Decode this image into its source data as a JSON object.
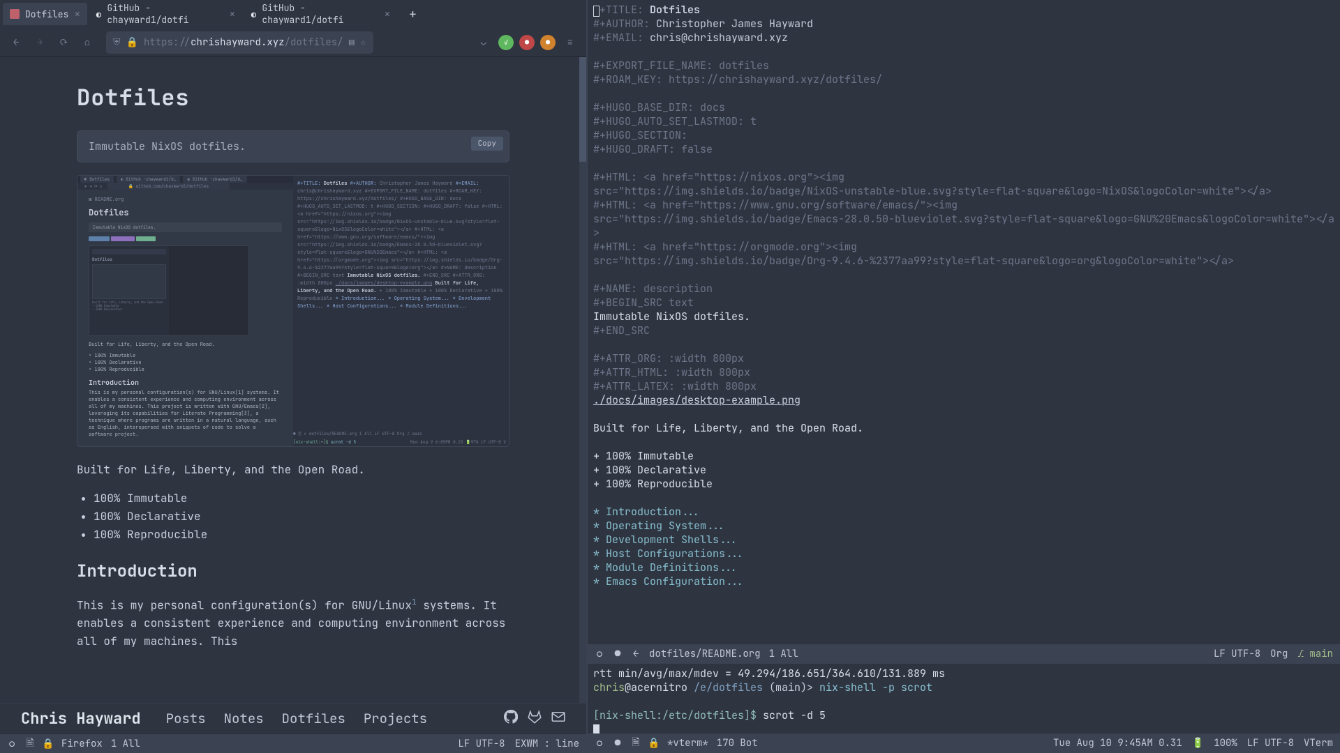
{
  "firefox": {
    "tabs": [
      {
        "label": "Dotfiles",
        "active": true
      },
      {
        "label": "GitHub - chayward1/dotfi"
      },
      {
        "label": "GitHub - chayward1/dotfi"
      }
    ],
    "url_prefix": "https://",
    "url_host": "chrishayward.xyz",
    "url_path": "/dotfiles/"
  },
  "page": {
    "title": "Dotfiles",
    "codebox": "Immutable NixOS dotfiles.",
    "copy": "Copy",
    "tagline": "Built for Life, Liberty, and the Open Road.",
    "features": [
      "100% Immutable",
      "100% Declarative",
      "100% Reproducible"
    ],
    "intro_heading": "Introduction",
    "intro_body_1": "This is my personal configuration(s) for GNU/Linux",
    "intro_sup": "1",
    "intro_body_2": " systems. It enables a consistent experience and computing environment across all of my machines. This"
  },
  "nav": {
    "brand": "Chris Hayward",
    "links": [
      "Posts",
      "Notes",
      "Dotfiles",
      "Projects"
    ]
  },
  "modeline_left": {
    "buffer": "Firefox",
    "pos": "1 All",
    "encoding": "LF UTF-8",
    "mode": "EXWM : line"
  },
  "editor": {
    "l01": {
      "k": "#+TITLE: ",
      "v": "Dotfiles"
    },
    "l02": {
      "k": "#+AUTHOR: ",
      "v": "Christopher James Hayward"
    },
    "l03": {
      "k": "#+EMAIL: ",
      "v": "chris@chrishayward.xyz"
    },
    "l04": "",
    "l05": "#+EXPORT_FILE_NAME: dotfiles",
    "l06": "#+ROAM_KEY: https://chrishayward.xyz/dotfiles/",
    "l07": "",
    "l08": "#+HUGO_BASE_DIR: docs",
    "l09": "#+HUGO_AUTO_SET_LASTMOD: t",
    "l10": "#+HUGO_SECTION:",
    "l11": "#+HUGO_DRAFT: false",
    "l12": "",
    "l13": "#+HTML: <a href=\"https://nixos.org\"><img",
    "l14": "src=\"https://img.shields.io/badge/NixOS-unstable-blue.svg?style=flat-square&logo=NixOS&logoColor=white\"></a>",
    "l15": "#+HTML: <a href=\"https://www.gnu.org/software/emacs/\"><img",
    "l16": "src=\"https://img.shields.io/badge/Emacs-28.0.50-blueviolet.svg?style=flat-square&logo=GNU%20Emacs&logoColor=white\"></a",
    "l17": ">",
    "l18": "#+HTML: <a href=\"https://orgmode.org\"><img",
    "l19": "src=\"https://img.shields.io/badge/Org-9.4.6-%2377aa99?style=flat-square&logo=org&logoColor=white\"></a>",
    "l20": "",
    "l21": "#+NAME: description",
    "l22": "#+BEGIN_SRC text",
    "l23": "Immutable NixOS dotfiles.",
    "l24": "#+END_SRC",
    "l25": "",
    "l26": "#+ATTR_ORG: :width 800px",
    "l27": "#+ATTR_HTML: :width 800px",
    "l28": "#+ATTR_LATEX: :width 800px",
    "l29": "./docs/images/desktop-example.png",
    "l30": "",
    "l31": "Built for Life, Liberty, and the Open Road.",
    "l32": "",
    "l33": "+ 100% Immutable",
    "l34": "+ 100% Declarative",
    "l35": "+ 100% Reproducible",
    "l36": "",
    "h1": "* Introduction...",
    "h2": "* Operating System...",
    "h3": "* Development Shells...",
    "h4": "* Host Configurations...",
    "h5": "* Module Definitions...",
    "h6": "* Emacs Configuration..."
  },
  "editor_status": {
    "file": "dotfiles/README.org",
    "pos": "1 All",
    "encoding": "LF UTF-8",
    "mode": "Org",
    "branch": "main"
  },
  "terminal": {
    "l1": "rtt min/avg/max/mdev = 49.294/186.651/364.610/131.889 ms",
    "p_user": "chris",
    "p_at": "@acernitro ",
    "p_path": "/e/dotfiles ",
    "p_branch": "(main)> ",
    "p_cmd": "nix-shell -p scrot",
    "nix_prompt": "[nix-shell:/etc/dotfiles]$ ",
    "nix_cmd": "scrot -d 5"
  },
  "term_status": {
    "buffer": "*vterm*",
    "pos": "170 Bot",
    "datetime": "Tue Aug 10 9:45AM 0.31",
    "battery": "100%",
    "encoding": "LF UTF-8",
    "mode": "VTerm"
  }
}
